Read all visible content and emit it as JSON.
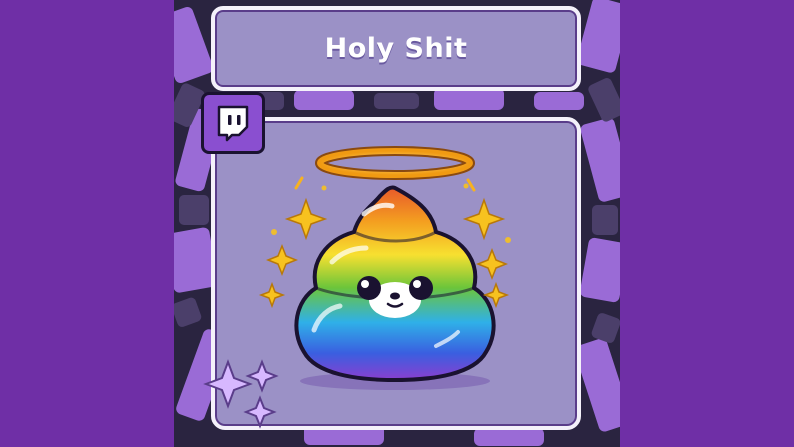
{
  "title": "Holy Shit",
  "colors": {
    "background": "#6f2fa6",
    "card": "#9b91c6",
    "card_border": "#f4f1fa",
    "accent": "#8a4fd0",
    "halo": "#f7b21f"
  },
  "icons": [
    "twitch-logo-icon",
    "halo-icon",
    "sparkle-icon",
    "rainbow-poop-emoji-icon"
  ]
}
